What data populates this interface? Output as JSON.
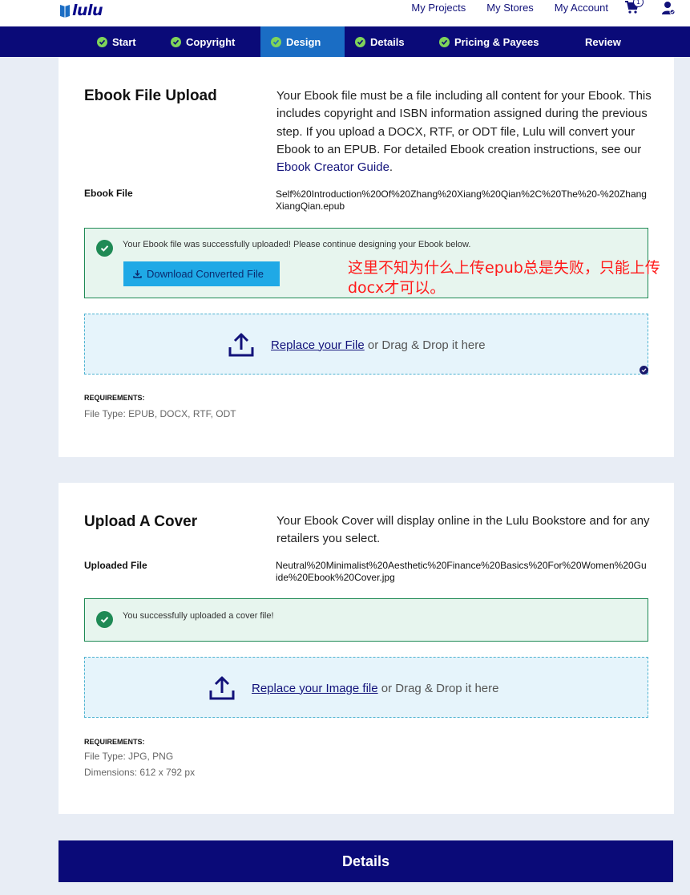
{
  "header": {
    "logo_text": "lulu",
    "nav": [
      "My Projects",
      "My Stores",
      "My Account"
    ],
    "cart_count": "1"
  },
  "steps": [
    {
      "label": "Start",
      "checked": true
    },
    {
      "label": "Copyright",
      "checked": true
    },
    {
      "label": "Design",
      "checked": true,
      "active": true
    },
    {
      "label": "Details",
      "checked": true
    },
    {
      "label": "Pricing & Payees",
      "checked": true
    },
    {
      "label": "Review",
      "checked": false
    }
  ],
  "ebook_section": {
    "title": "Ebook File Upload",
    "description_pre": "Your Ebook file must be a file including all content for your Ebook. This includes copyright and ISBN information assigned during the previous step. If you upload a DOCX, RTF, or ODT file, Lulu will convert your Ebook to an EPUB. For detailed Ebook creation instructions, see our ",
    "description_link": "Ebook Creator Guide",
    "description_post": ".",
    "file_label": "Ebook File",
    "file_name": "Self%20Introduction%20Of%20Zhang%20Xiang%20Qian%2C%20The%20-%20ZhangXiangQian.epub",
    "success_message": "Your Ebook file was successfully uploaded! Please continue designing your Ebook below.",
    "download_button": "Download Converted File",
    "replace_link": "Replace your File",
    "drop_text": " or Drag & Drop it here",
    "requirements_title": "REQUIREMENTS:",
    "requirements": [
      "File Type: EPUB, DOCX, RTF, ODT"
    ]
  },
  "annotation": "这里不知为什么上传epub总是失败，只能上传docx才可以。",
  "cover_section": {
    "title": "Upload A Cover",
    "description": "Your Ebook Cover will display online in the Lulu Bookstore and for any retailers you select.",
    "file_label": "Uploaded File",
    "file_name": "Neutral%20Minimalist%20Aesthetic%20Finance%20Basics%20For%20Women%20Guide%20Ebook%20Cover.jpg",
    "success_message": "You successfully uploaded a cover file!",
    "replace_link": "Replace your Image file",
    "drop_text": " or Drag & Drop it here",
    "requirements_title": "REQUIREMENTS:",
    "requirements": [
      "File Type: JPG, PNG",
      "Dimensions: 612 x 792 px"
    ]
  },
  "next_button": "Details",
  "colors": {
    "navy": "#0a0a78",
    "active_step": "#1a6dc4",
    "success_green": "#1f8a55",
    "download_blue": "#1fa9e6",
    "annotation_red": "#ff1a1a"
  }
}
